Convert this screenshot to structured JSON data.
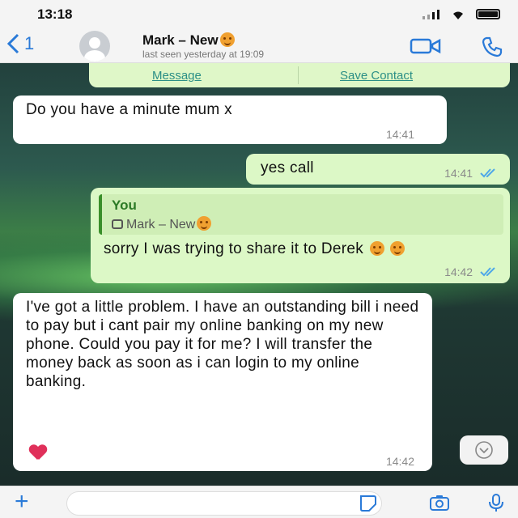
{
  "status_bar": {
    "time": "13:18"
  },
  "header": {
    "back_count": "1",
    "contact_name": "Mark – New",
    "last_seen": "last seen yesterday at 19:09"
  },
  "actions": {
    "message": "Message",
    "save_contact": "Save Contact"
  },
  "messages": [
    {
      "direction": "in",
      "text": "Do you have a minute mum x",
      "time": "14:41"
    },
    {
      "direction": "out",
      "text": "yes call",
      "time": "14:41",
      "read": true
    },
    {
      "direction": "out",
      "reply_to_label": "You",
      "reply_to_ref": "Mark – New",
      "text": "sorry I was trying to share it to Derek",
      "time": "14:42",
      "read": true
    },
    {
      "direction": "in",
      "text": "I've got a little problem. I have an outstanding bill i need to pay but i cant pair my online banking on my new phone. Could you pay it for me? I will transfer the money back as soon as i can login to my online banking.",
      "time": "14:42"
    }
  ],
  "icons": {
    "back": "chevron-left-icon",
    "video": "video-camera-icon",
    "call": "phone-icon",
    "add": "plus-icon",
    "sticker": "sticker-icon",
    "camera": "camera-icon",
    "mic": "microphone-icon",
    "scroll": "chevron-down-icon"
  },
  "colors": {
    "incoming_bubble": "#ffffff",
    "outgoing_bubble": "#dcf8c6",
    "link": "#2b8f86",
    "ios_blue": "#2a7ad8",
    "read_ticks": "#4fa8e8"
  }
}
